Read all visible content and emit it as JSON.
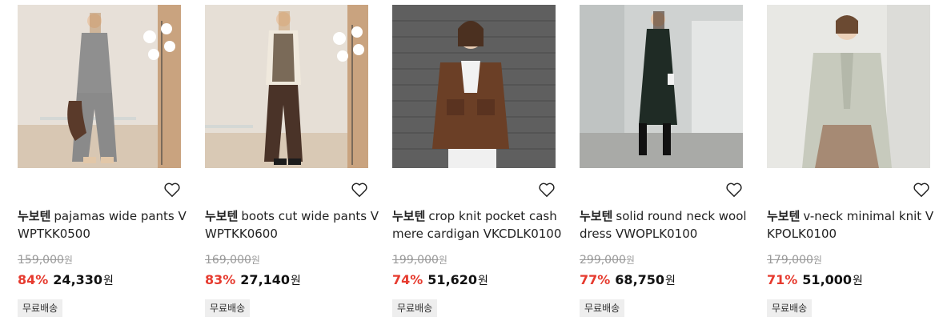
{
  "products": [
    {
      "brand": "누보텐",
      "name": "pajamas wide pants VWPTKK0500",
      "original_price": "159,000",
      "discount": "84%",
      "price": "24,330",
      "currency": "원",
      "badge": "무료배송"
    },
    {
      "brand": "누보텐",
      "name": "boots cut wide pants VWPTKK0600",
      "original_price": "169,000",
      "discount": "83%",
      "price": "27,140",
      "currency": "원",
      "badge": "무료배송"
    },
    {
      "brand": "누보텐",
      "name": "crop knit pocket cashmere cardigan VKCDLK0100",
      "original_price": "199,000",
      "discount": "74%",
      "price": "51,620",
      "currency": "원",
      "badge": "무료배송"
    },
    {
      "brand": "누보텐",
      "name": "solid round neck wool dress VWOPLK0100",
      "original_price": "299,000",
      "discount": "77%",
      "price": "68,750",
      "currency": "원",
      "badge": "무료배송"
    },
    {
      "brand": "누보텐",
      "name": "v-neck minimal knit VKPOLK0100",
      "original_price": "179,000",
      "discount": "71%",
      "price": "51,000",
      "currency": "원",
      "badge": "무료배송"
    }
  ],
  "colors": {
    "discount": "#e63a2e",
    "strikethrough": "#9a9a9a",
    "badge_bg": "#eeeeee"
  },
  "icons": {
    "wishlist": "heart-outline-icon"
  }
}
